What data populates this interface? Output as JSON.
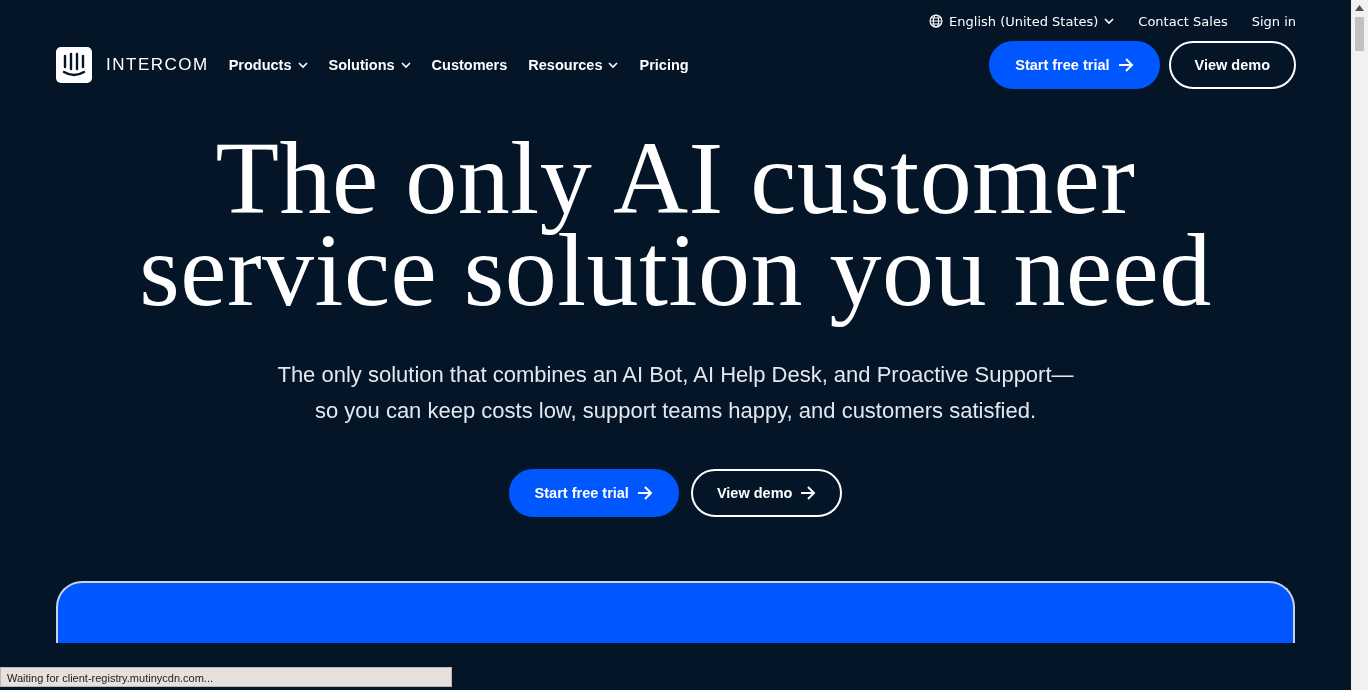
{
  "utility_bar": {
    "language": "English (United States)",
    "links": [
      "Contact Sales",
      "Sign in"
    ]
  },
  "nav": {
    "brand": "INTERCOM",
    "items": [
      {
        "label": "Products",
        "has_menu": true
      },
      {
        "label": "Solutions",
        "has_menu": true
      },
      {
        "label": "Customers",
        "has_menu": false
      },
      {
        "label": "Resources",
        "has_menu": true
      },
      {
        "label": "Pricing",
        "has_menu": false
      }
    ],
    "buttons": [
      {
        "label": "Start free trial",
        "kind": "primary",
        "arrow": true
      },
      {
        "label": "View demo",
        "kind": "outline",
        "arrow": false
      }
    ]
  },
  "hero": {
    "title_lines": [
      "The only AI customer",
      "service solution you need"
    ],
    "subtitle": "The only solution that combines an AI Bot, AI Help Desk, and Proactive Support—so you can keep costs low, support teams happy, and customers satisfied.",
    "buttons": [
      {
        "label": "Start free trial",
        "kind": "primary",
        "arrow": true
      },
      {
        "label": "View demo",
        "kind": "outline",
        "arrow": true
      }
    ]
  },
  "status_bar": "Waiting for client-registry.mutinycdn.com..."
}
